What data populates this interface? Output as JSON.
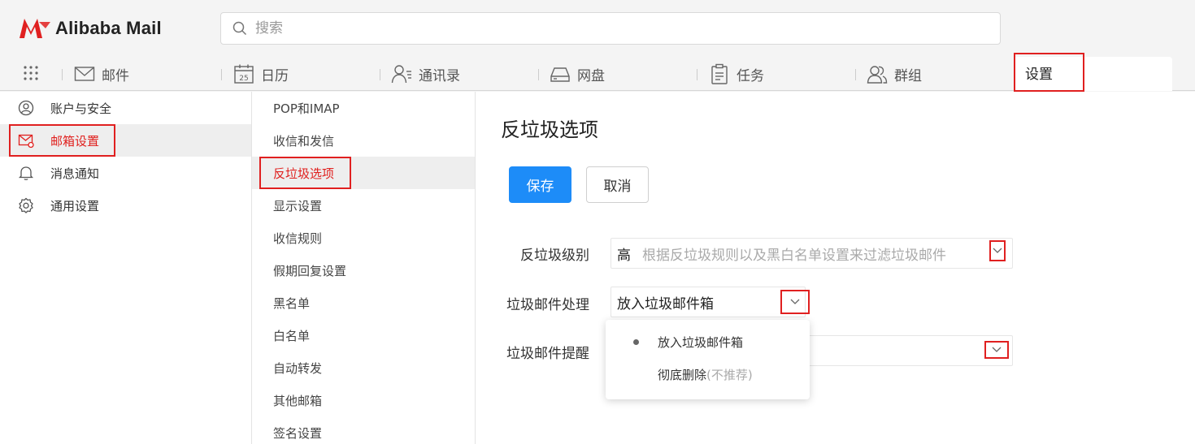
{
  "app": {
    "brand": "Alibaba Mail",
    "brand_color": "#e02020",
    "accent_color": "#1d8cf8"
  },
  "search": {
    "placeholder": "搜索"
  },
  "nav": {
    "tabs": [
      {
        "label": "邮件",
        "icon": "mail-icon"
      },
      {
        "label": "日历",
        "icon": "calendar-icon",
        "icon_text": "25"
      },
      {
        "label": "通讯录",
        "icon": "contacts-icon"
      },
      {
        "label": "网盘",
        "icon": "drive-icon"
      },
      {
        "label": "任务",
        "icon": "task-icon"
      },
      {
        "label": "群组",
        "icon": "group-icon"
      },
      {
        "label": "设置",
        "icon": ""
      }
    ],
    "active": "设置"
  },
  "sidebar": {
    "items": [
      {
        "label": "账户与安全",
        "icon": "user-circle-icon"
      },
      {
        "label": "邮箱设置",
        "icon": "mail-settings-icon"
      },
      {
        "label": "消息通知",
        "icon": "bell-icon"
      },
      {
        "label": "通用设置",
        "icon": "gear-icon"
      }
    ],
    "active": "邮箱设置"
  },
  "subnav": {
    "items": [
      "POP和IMAP",
      "收信和发信",
      "反垃圾选项",
      "显示设置",
      "收信规则",
      "假期回复设置",
      "黑名单",
      "白名单",
      "自动转发",
      "其他邮箱",
      "签名设置"
    ],
    "active": "反垃圾选项"
  },
  "main": {
    "title": "反垃圾选项",
    "save_label": "保存",
    "cancel_label": "取消",
    "fields": {
      "level": {
        "label": "反垃圾级别",
        "value": "高",
        "hint": "根据反垃圾规则以及黑白名单设置来过滤垃圾邮件"
      },
      "handling": {
        "label": "垃圾邮件处理",
        "value": "放入垃圾邮件箱"
      },
      "reminder": {
        "label": "垃圾邮件提醒",
        "value": ""
      }
    },
    "dropdown": {
      "options": [
        {
          "label": "放入垃圾邮件箱",
          "note": "",
          "selected": true
        },
        {
          "label": "彻底删除",
          "note": "(不推荐)",
          "selected": false
        }
      ]
    }
  }
}
